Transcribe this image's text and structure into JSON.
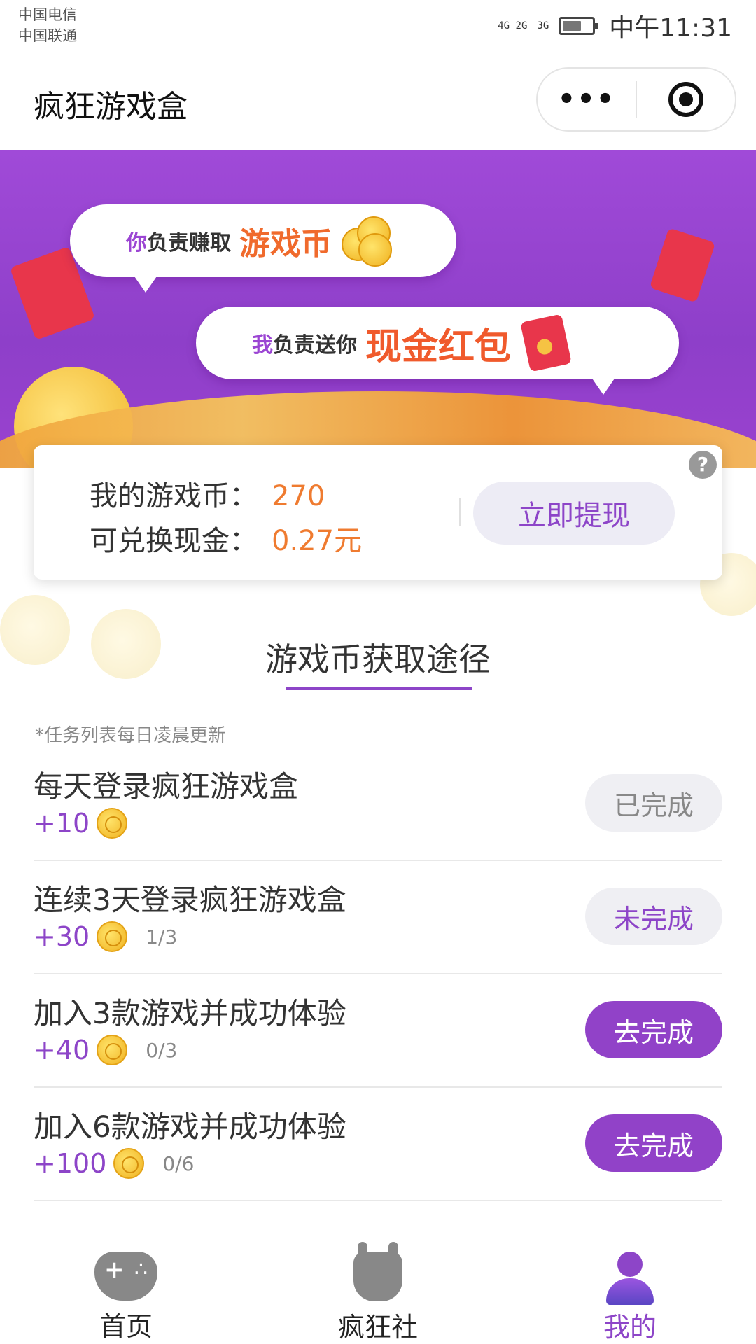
{
  "status_bar": {
    "carrier_1": "中国电信",
    "carrier_2": "中国联通",
    "signal_1": "4G 2G",
    "signal_2": "3G",
    "time": "中午11:31",
    "battery_level": 0.65
  },
  "navbar": {
    "title": "疯狂游戏盒",
    "more_label": "•••"
  },
  "banner": {
    "line1_lead": "你",
    "line1_mid": "负责赚取",
    "line1_highlight": "游戏币",
    "line2_lead": "我",
    "line2_mid": "负责送你",
    "line2_highlight": "现金红包"
  },
  "balance": {
    "coins_label": "我的游戏币：",
    "coins_value": "270",
    "cash_label": "可兑换现金：",
    "cash_value": "0.27元",
    "withdraw_label": "立即提现",
    "help_label": "?"
  },
  "section": {
    "title": "游戏币获取途径",
    "note": "*任务列表每日凌晨更新"
  },
  "tasks": [
    {
      "name": "每天登录疯狂游戏盒",
      "reward": "+10",
      "progress": "",
      "button": "已完成",
      "state": "done"
    },
    {
      "name": "连续3天登录疯狂游戏盒",
      "reward": "+30",
      "progress": "1/3",
      "button": "未完成",
      "state": "incomplete"
    },
    {
      "name": "加入3款游戏并成功体验",
      "reward": "+40",
      "progress": "0/3",
      "button": "去完成",
      "state": "go"
    },
    {
      "name": "加入6款游戏并成功体验",
      "reward": "+100",
      "progress": "0/6",
      "button": "去完成",
      "state": "go"
    }
  ],
  "tabbar": {
    "items": [
      {
        "label": "首页",
        "icon": "gamepad-icon",
        "active": false
      },
      {
        "label": "疯狂社",
        "icon": "rock-hand-icon",
        "active": false
      },
      {
        "label": "我的",
        "icon": "person-icon",
        "active": true
      }
    ]
  },
  "colors": {
    "accent": "#8d45c8",
    "banner": "#9b44d3",
    "value_orange": "#ef7b30",
    "highlight_orange": "#f06a2c"
  }
}
